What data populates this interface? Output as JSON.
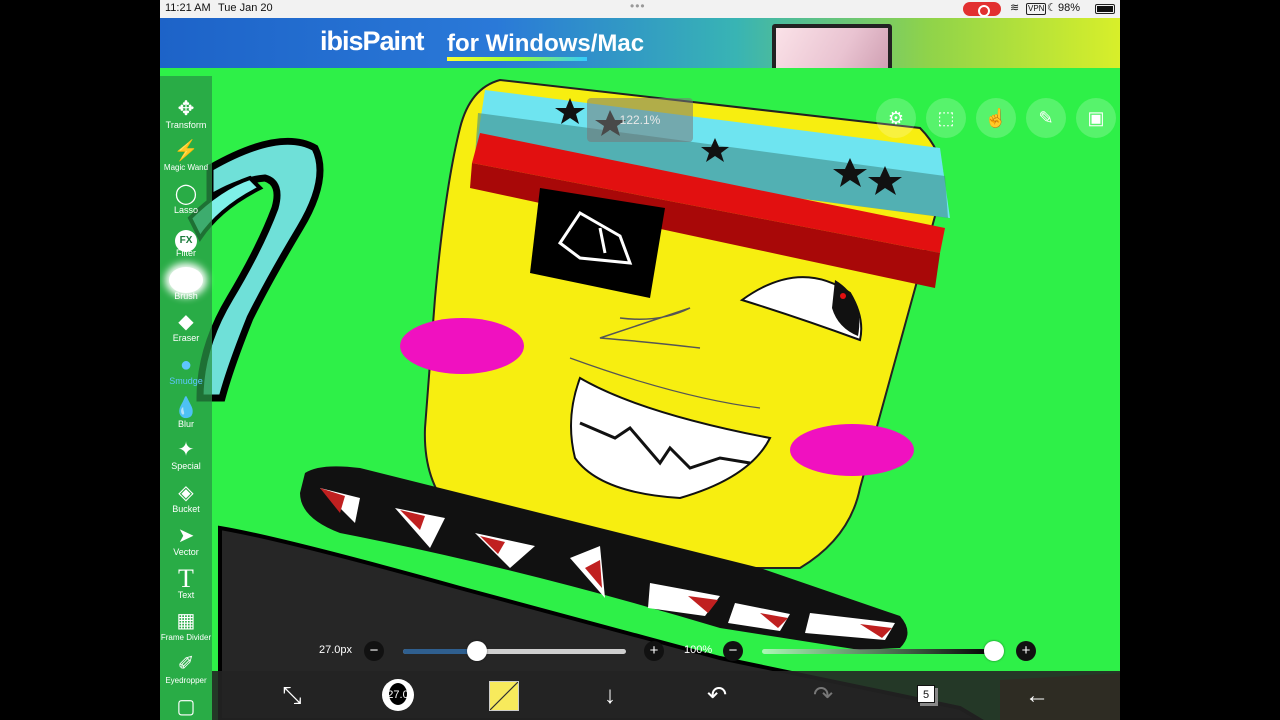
{
  "status_bar": {
    "time": "11:21 AM",
    "date": "Tue Jan 20",
    "vpn": "VPN",
    "battery": "98%"
  },
  "banner": {
    "logo": "ibisPaint",
    "tagline": "for Windows/Mac"
  },
  "toolbar": {
    "items": [
      {
        "label": "Transform",
        "icon": "transform-icon"
      },
      {
        "label": "Magic Wand",
        "icon": "magic-wand-icon"
      },
      {
        "label": "Lasso",
        "icon": "lasso-icon"
      },
      {
        "label": "Filter",
        "icon": "filter-icon"
      },
      {
        "label": "Brush",
        "icon": "brush-icon"
      },
      {
        "label": "Eraser",
        "icon": "eraser-icon"
      },
      {
        "label": "Smudge",
        "icon": "smudge-icon",
        "active": true
      },
      {
        "label": "Blur",
        "icon": "blur-icon"
      },
      {
        "label": "Special",
        "icon": "special-icon"
      },
      {
        "label": "Bucket",
        "icon": "bucket-icon"
      },
      {
        "label": "Vector",
        "icon": "vector-icon"
      },
      {
        "label": "Text",
        "icon": "text-icon"
      },
      {
        "label": "Frame Divider",
        "icon": "frame-divider-icon"
      },
      {
        "label": "Eyedropper",
        "icon": "eyedropper-icon"
      }
    ],
    "filter_glyph": "FX",
    "text_glyph": "T"
  },
  "zoom": {
    "value": "122.1%"
  },
  "brush": {
    "size_label": "27.0px",
    "size_fraction": 0.33,
    "opacity_label": "100%",
    "opacity_fraction": 1.0,
    "minus": "−",
    "plus": "+"
  },
  "bottom_bar": {
    "brush_preview_value": "27.0",
    "layers_count": "5"
  },
  "colors": {
    "canvas_bg": "#2ef048",
    "accent_active": "#5ec6ff",
    "primary_color": "#f7ea5c"
  }
}
